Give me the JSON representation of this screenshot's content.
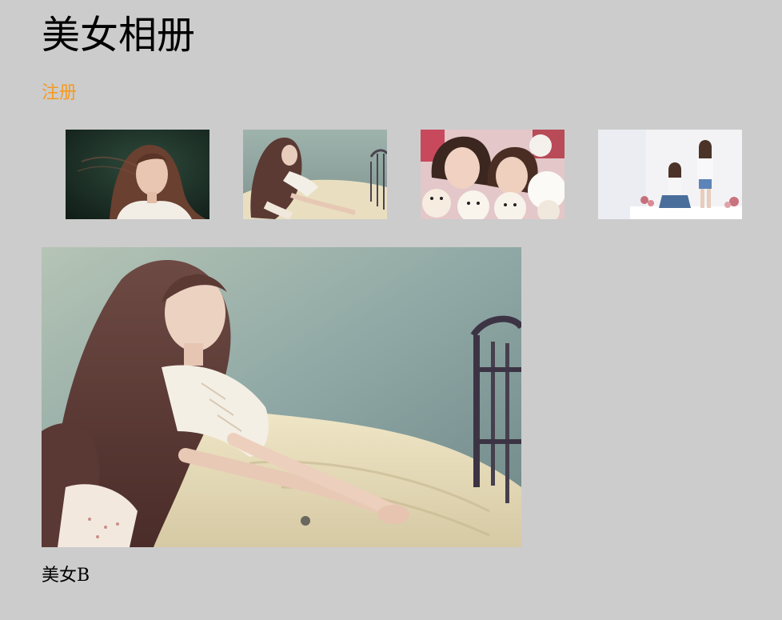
{
  "page": {
    "title": "美女相册",
    "register_link": "注册",
    "link_color": "#f59a23",
    "background": "#cccccc"
  },
  "gallery": {
    "thumbnails": [
      {
        "name": "thumbnail-portrait-dark-background",
        "selected": false
      },
      {
        "name": "thumbnail-girl-on-bed",
        "selected": true
      },
      {
        "name": "thumbnail-two-girls-with-plush-toys",
        "selected": false
      },
      {
        "name": "thumbnail-two-girls-white-room",
        "selected": false
      }
    ]
  },
  "display": {
    "caption": "美女B"
  }
}
